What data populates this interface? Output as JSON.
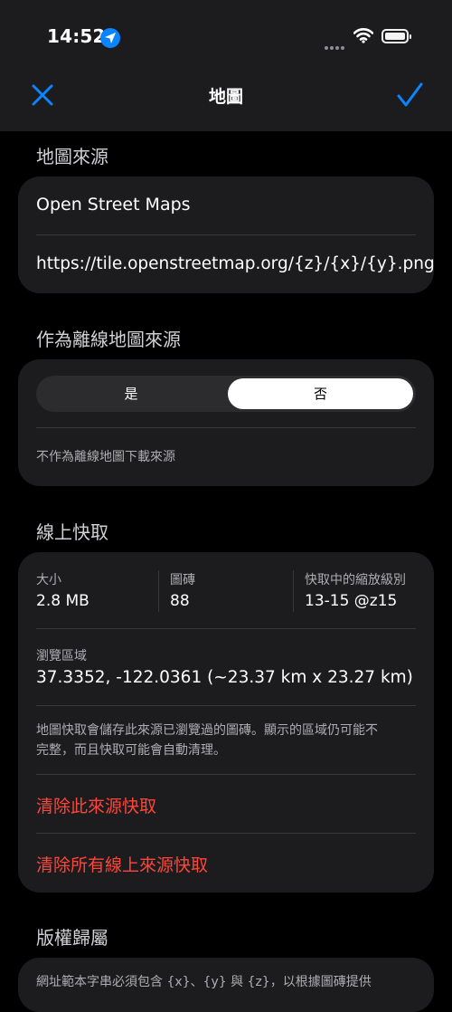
{
  "status_bar": {
    "time": "14:52"
  },
  "nav": {
    "title": "地圖"
  },
  "sections": {
    "source": {
      "title": "地圖來源",
      "name": "Open Street Maps",
      "url": "https://tile.openstreetmap.org/{z}/{x}/{y}.png"
    },
    "offline": {
      "title": "作為離線地圖來源",
      "options": [
        "是",
        "否"
      ],
      "selected": "否",
      "note": "不作為離線地圖下載來源"
    },
    "cache": {
      "title": "線上快取",
      "stats": [
        {
          "label": "大小",
          "value": "2.8 MB"
        },
        {
          "label": "圖磚",
          "value": "88"
        },
        {
          "label": "快取中的縮放級別",
          "value": "13-15 @z15"
        }
      ],
      "area_label": "瀏覽區域",
      "area_value": "37.3352, -122.0361  (~23.37 km x 23.27 km)",
      "note_line1": "地圖快取會儲存此來源已瀏覽過的圖磚。顯示的區域仍可能不",
      "note_line2": "完整，而且快取可能會自動清理。",
      "clear_this": "清除此來源快取",
      "clear_all": "清除所有線上來源快取"
    },
    "attribution": {
      "title": "版權歸屬",
      "partial_text": "網址範本字串必須包含 {x}、{y} 與 {z}，以根據圖磚提供"
    }
  },
  "colors": {
    "accent": "#0a84ff",
    "danger": "#ff453a",
    "card": "#1c1c1e",
    "background": "#000000"
  }
}
